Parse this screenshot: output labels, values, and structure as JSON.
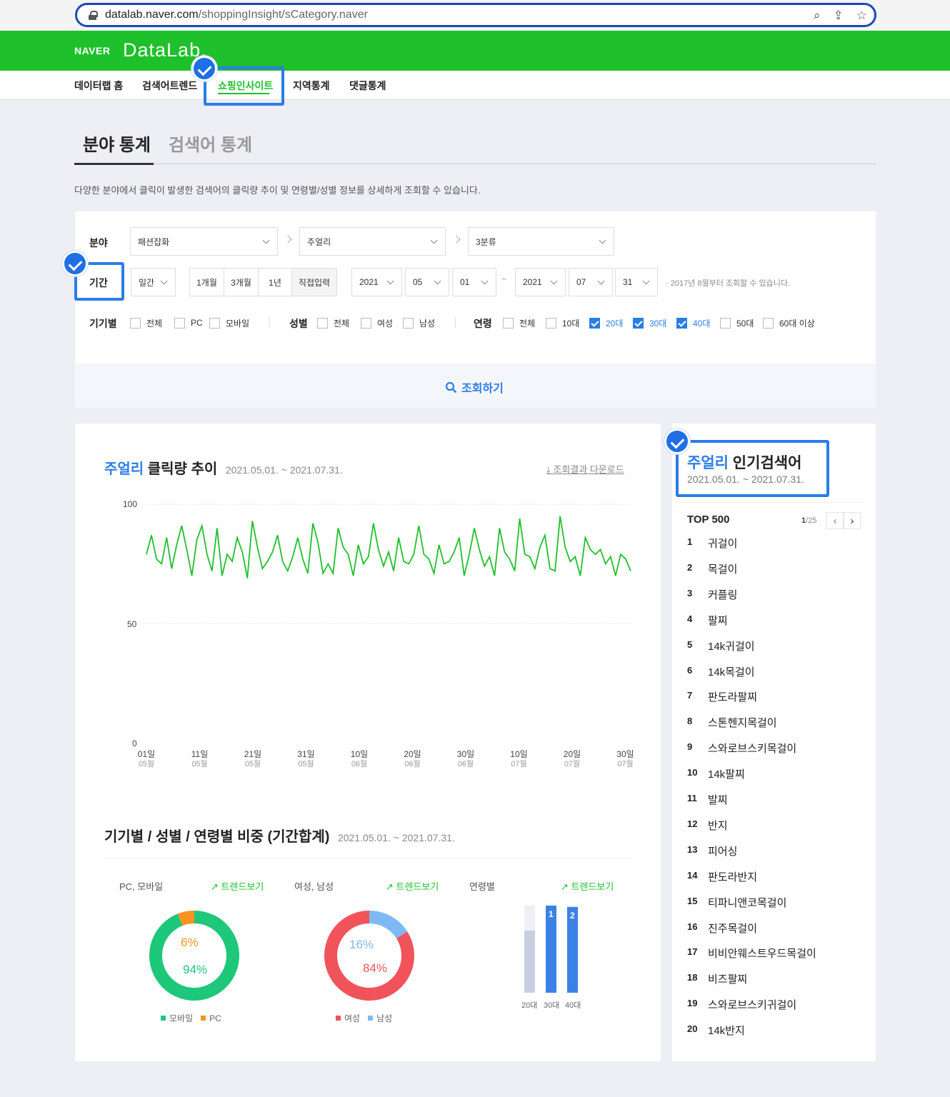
{
  "browser": {
    "url_domain": "datalab.naver.com",
    "url_path": "/shoppingInsight/sCategory.naver"
  },
  "brand": {
    "naver": "NAVER",
    "datalab": "DataLab."
  },
  "nav": [
    "데이터랩 홈",
    "검색어트렌드",
    "쇼핑인사이트",
    "지역통계",
    "댓글통계"
  ],
  "tabs": [
    "분야 통계",
    "검색어 통계"
  ],
  "description": "다양한 분야에서 클릭이 발생한 검색어의 클릭량 추이 및 연령별/성별 정보를 상세하게 조회할 수 있습니다.",
  "filter": {
    "category_label": "분야",
    "cat1": "패션잡화",
    "cat2": "주얼리",
    "cat3": "3분류",
    "period_label": "기간",
    "period_unit": "일간",
    "period_btns": [
      "1개월",
      "3개월",
      "1년",
      "직접입력"
    ],
    "start_year": "2021",
    "start_month": "05",
    "start_day": "01",
    "tilde": "~",
    "end_year": "2021",
    "end_month": "07",
    "end_day": "31",
    "note": "· 2017년 8월부터 조회할 수 있습니다.",
    "device_label": "기기별",
    "device_opts": [
      "전체",
      "PC",
      "모바일"
    ],
    "gender_label": "성별",
    "gender_opts": [
      "전체",
      "여성",
      "남성"
    ],
    "age_label": "연령",
    "age_opts": [
      "전체",
      "10대",
      "20대",
      "30대",
      "40대",
      "50대",
      "60대 이상"
    ],
    "age_checked": [
      false,
      false,
      true,
      true,
      true,
      false,
      false
    ],
    "search_btn": "조회하기"
  },
  "chart": {
    "title_hl": "주얼리",
    "title_rest": " 클릭량 추이",
    "date_range": "2021.05.01. ~ 2021.07.31.",
    "download": "조회결과 다운로드",
    "yticks": [
      "100",
      "50",
      "0"
    ],
    "xticks": [
      {
        "d": "01일",
        "m": "05월"
      },
      {
        "d": "11일",
        "m": "05월"
      },
      {
        "d": "21일",
        "m": "05월"
      },
      {
        "d": "31일",
        "m": "05월"
      },
      {
        "d": "10일",
        "m": "06월"
      },
      {
        "d": "20일",
        "m": "06월"
      },
      {
        "d": "30일",
        "m": "06월"
      },
      {
        "d": "10일",
        "m": "07월"
      },
      {
        "d": "20일",
        "m": "07월"
      },
      {
        "d": "30일",
        "m": "07월"
      }
    ]
  },
  "chart_data": {
    "type": "line",
    "ylim": [
      0,
      100
    ],
    "color": "#1ec02b",
    "values": [
      79,
      87,
      77,
      75,
      86,
      73,
      83,
      91,
      81,
      70,
      85,
      91,
      79,
      72,
      90,
      70,
      79,
      76,
      86,
      80,
      69,
      93,
      82,
      73,
      76,
      80,
      87,
      76,
      72,
      78,
      86,
      77,
      71,
      92,
      84,
      71,
      75,
      71,
      90,
      82,
      79,
      70,
      83,
      75,
      78,
      92,
      81,
      74,
      80,
      72,
      86,
      76,
      75,
      79,
      91,
      79,
      77,
      71,
      83,
      75,
      76,
      80,
      86,
      70,
      79,
      90,
      81,
      74,
      78,
      70,
      90,
      80,
      77,
      72,
      94,
      79,
      78,
      73,
      82,
      87,
      73,
      72,
      95,
      82,
      76,
      78,
      70,
      86,
      81,
      79,
      81,
      75,
      78,
      70,
      79,
      77,
      72
    ]
  },
  "sec2": {
    "title": "기기별 / 성별 / 연령별 비중 (기간합계)",
    "date_range": "2021.05.01. ~ 2021.07.31.",
    "device": {
      "label": "PC, 모바일",
      "trend": "트렌드보기",
      "values": [
        94,
        6
      ],
      "labels": [
        "94%",
        "6%"
      ],
      "legend": [
        "모바일",
        "PC"
      ],
      "colors": [
        "#1ec77a",
        "#f7931e"
      ]
    },
    "gender": {
      "label": "여성, 남성",
      "trend": "트렌드보기",
      "values": [
        84,
        16
      ],
      "labels": [
        "84%",
        "16%"
      ],
      "legend": [
        "여성",
        "남성"
      ],
      "colors": [
        "#f0545a",
        "#7fb9f5"
      ]
    },
    "age": {
      "label": "연령별",
      "trend": "트렌드보기",
      "categories": [
        "20대",
        "30대",
        "40대"
      ],
      "ranks": [
        "",
        "1",
        "2"
      ]
    }
  },
  "ranking": {
    "title_hl": "주얼리",
    "title_rest": " 인기검색어",
    "date_range": "2021.05.01. ~ 2021.07.31.",
    "top": "TOP 500",
    "page": "1",
    "total": "/25",
    "items": [
      "귀걸이",
      "목걸이",
      "커플링",
      "팔찌",
      "14k귀걸이",
      "14k목걸이",
      "판도라팔찌",
      "스톤헨지목걸이",
      "스와로브스키목걸이",
      "14k팔찌",
      "발찌",
      "반지",
      "피어싱",
      "판도라반지",
      "티파니앤코목걸이",
      "진주목걸이",
      "비비안웨스트우드목걸이",
      "비즈팔찌",
      "스와로브스키귀걸이",
      "14k반지"
    ]
  }
}
